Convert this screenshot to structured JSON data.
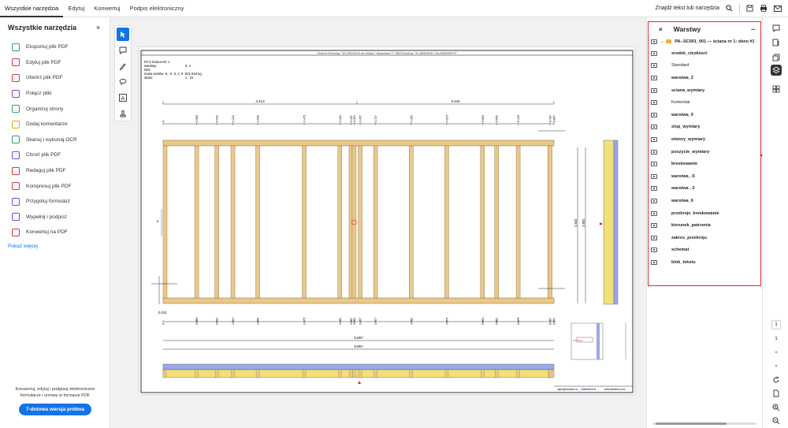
{
  "topbar": {
    "tabs": [
      "Wszystkie narzędzia",
      "Edytuj",
      "Konwertuj",
      "Podpis elektroniczny"
    ],
    "search_label": "Znajdź tekst lub narzędzia"
  },
  "sidebar": {
    "title": "Wszystkie narzędzia",
    "tools": [
      {
        "label": "Eksportuj plik PDF",
        "color": "#2d9d78"
      },
      {
        "label": "Edytuj plik PDF",
        "color": "#d7373f"
      },
      {
        "label": "Utwórz plik PDF",
        "color": "#d7373f"
      },
      {
        "label": "Połącz pliki",
        "color": "#6e4ed9"
      },
      {
        "label": "Organizuj strony",
        "color": "#2d9d78"
      },
      {
        "label": "Dodaj komentarze",
        "color": "#e8a90c"
      },
      {
        "label": "Skanuj i wykonaj OCR",
        "color": "#2d9d78"
      },
      {
        "label": "Chroń plik PDF",
        "color": "#6e4ed9"
      },
      {
        "label": "Redaguj plik PDF",
        "color": "#d7373f"
      },
      {
        "label": "Kompresuj plik PDF",
        "color": "#d7373f"
      },
      {
        "label": "Przygotuj formularz",
        "color": "#6e4ed9"
      },
      {
        "label": "Wypełnij i podpisz",
        "color": "#6e4ed9"
      },
      {
        "label": "Konwertuj na PDF",
        "color": "#d7373f"
      }
    ],
    "more": "Pokaż więcej",
    "promo_line1": "Konwertuj, edytuj i podpisuj elektroniczne",
    "promo_line2": "formularze i umowy w formacie PDF",
    "promo_button": "7-dniowa wersja próbna"
  },
  "document": {
    "header_line": "\" Dietrich's Technology \" 3D CAD/CAM für den Holzbau \" Hauptstrasse 77 \" 85570 Hochburg \" Tel. 08649/1842-0, Fax 08649/1842-44 \"",
    "info": [
      "PA 0 ściana-SC 1",
      "warstwy :",
      "NrS:",
      "masa warstw -5, -2, 0, 2, 6 :",
      "skala:"
    ],
    "info_values": [
      "",
      "0, 4",
      "",
      "821.518 kg",
      "1 : 21"
    ],
    "top_dims": [
      "3.413",
      "3.444"
    ],
    "stud_dims": [
      "0",
      "0.589",
      "0.942",
      "1.224",
      "1.660",
      "2.475",
      "3.101",
      "3.297",
      "3.351",
      "3.457",
      "3.727",
      "4.352",
      "4.976",
      "5.603",
      "5.851",
      "6.229",
      "6.787",
      "6.857"
    ],
    "height_dims": [
      "2.602",
      "2.802"
    ],
    "bottom_left": "0.012",
    "total1": "6.857",
    "total2": "6.857",
    "footer": "zaprojektowano w:",
    "footer_brand": "Dietrich's",
    "footer_url": "www.dietrichs.com"
  },
  "layers_panel": {
    "title": "Warstwy",
    "root": "PA--SC001_001 — ściana nr 1: okno #1",
    "layers": [
      {
        "label": "srodek_ciezkosci",
        "bold": true
      },
      {
        "label": "Standard",
        "bold": false
      },
      {
        "label": "warstwa_2",
        "bold": true
      },
      {
        "label": "sciana_wymiary",
        "bold": true
      },
      {
        "label": "Komentar",
        "bold": false
      },
      {
        "label": "warstwa_0",
        "bold": true
      },
      {
        "label": "slup_wymiary",
        "bold": true
      },
      {
        "label": "otwory_wymiary",
        "bold": true
      },
      {
        "label": "poszycie_wymiary",
        "bold": true
      },
      {
        "label": "kreskowanie",
        "bold": true
      },
      {
        "label": "warstwa_-5",
        "bold": true
      },
      {
        "label": "warstwa_-2",
        "bold": true
      },
      {
        "label": "warstwa_6",
        "bold": true
      },
      {
        "label": "przekroje_kreskowanie",
        "bold": true
      },
      {
        "label": "kierunek_patrzenia",
        "bold": true
      },
      {
        "label": "zakres_przekroju",
        "bold": true
      },
      {
        "label": "schemat",
        "bold": true
      },
      {
        "label": "blok_tekstu",
        "bold": true
      }
    ]
  },
  "pagination": {
    "current": "1",
    "total": "1"
  },
  "colors": {
    "accent": "#1473e6",
    "highlight": "#e0282e",
    "wood": "#e8c88c",
    "insulation": "#f1e07a",
    "board": "#9aa8e8"
  }
}
